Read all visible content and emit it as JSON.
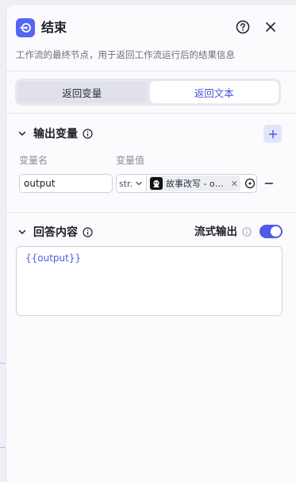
{
  "node": {
    "title": "结束",
    "description": "工作流的最终节点，用于返回工作流运行后的结果信息"
  },
  "tabs": [
    {
      "label": "返回变量",
      "active": false
    },
    {
      "label": "返回文本",
      "active": true
    }
  ],
  "output_section": {
    "title": "输出变量",
    "col_name": "变量名",
    "col_value": "变量值",
    "rows": [
      {
        "name": "output",
        "type": "str.",
        "ref_label": "故事改写 - o…"
      }
    ]
  },
  "answer_section": {
    "title": "回答内容",
    "stream_label": "流式输出",
    "stream_enabled": true,
    "content": "{{output}}"
  },
  "colors": {
    "accent": "#4f5ae6",
    "icon_bg": "#5664f5",
    "add_bg": "#e2e4fb",
    "panel_bg": "#fbfbfd"
  },
  "icons": [
    "end-node-icon",
    "help-icon",
    "close-icon",
    "chevron-down-icon",
    "info-icon",
    "plus-icon",
    "minus-icon",
    "target-icon",
    "bot-icon"
  ]
}
